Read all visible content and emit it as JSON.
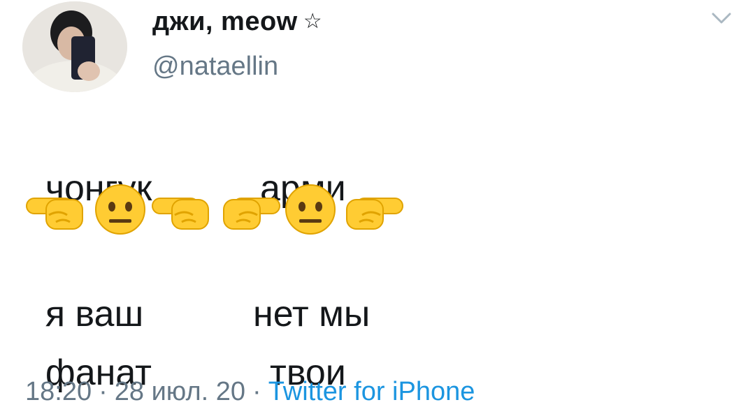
{
  "tweet": {
    "display_name": "джи, meow",
    "name_icon": "star-outline-icon",
    "handle": "@nataellin",
    "menu_icon": "chevron-down-icon",
    "lines": [
      {
        "left": "чонгук",
        "right": "арми"
      },
      {
        "left": "я ваш",
        "right": "нет мы"
      },
      {
        "left": "фанат",
        "right": "твои"
      }
    ],
    "emoji_row": [
      "left-facing-fist-icon",
      "neutral-face-icon",
      "left-facing-fist-icon",
      "right-facing-fist-icon",
      "neutral-face-icon",
      "right-facing-fist-icon"
    ],
    "time": "18:20",
    "date": "28 июл. 20",
    "separator": "·",
    "source": "Twitter for iPhone"
  },
  "colors": {
    "text": "#14171a",
    "secondary": "#657786",
    "link": "#1b95e0",
    "emoji_yellow": "#ffcc33"
  }
}
